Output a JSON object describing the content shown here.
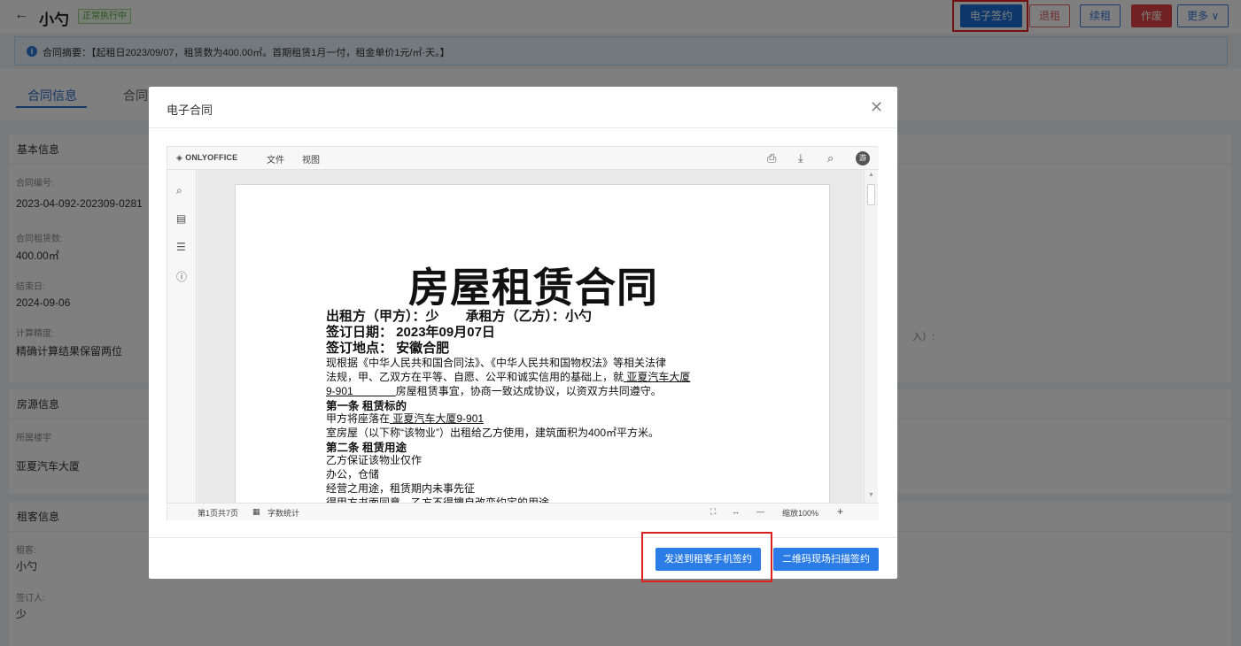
{
  "header": {
    "back_icon": "arrow-left-icon",
    "title": "小勺",
    "status": "正常执行中",
    "buttons": {
      "esign": "电子签约",
      "return": "退租",
      "renew": "续租",
      "void": "作废",
      "more": "更多 ∨"
    }
  },
  "summary": {
    "icon": "info-icon",
    "text": "合同摘要：【起租日2023/09/07，租赁数为400.00㎡。首期租赁1月一付，租金单价1元/㎡·天。】"
  },
  "tabs": [
    "合同信息",
    "合同"
  ],
  "basic_info": {
    "heading": "基本信息",
    "fields": [
      {
        "label": "合同编号:",
        "value": "2023-04-092-202309-0281"
      },
      {
        "label": "合同租赁数:",
        "value": "400.00㎡"
      },
      {
        "label": "结束日:",
        "value": "2024-09-06"
      },
      {
        "label": "计算精度:",
        "value": "精确计算结果保留两位"
      }
    ],
    "right_fragment": "入）:"
  },
  "property_info": {
    "heading": "房源信息",
    "fields": [
      {
        "label": "所属楼宇",
        "value": "亚夏汽车大厦"
      }
    ]
  },
  "tenant_info": {
    "heading": "租客信息",
    "fields": [
      {
        "label": "租客:",
        "value": "小勺"
      },
      {
        "label": "签订人:",
        "value": "少"
      }
    ]
  },
  "modal": {
    "title": "电子合同",
    "close_icon": "close-icon",
    "viewer": {
      "logo": "ONLYOFFICE",
      "menu": [
        "文件",
        "视图"
      ],
      "toolbar_icons": [
        "print-icon",
        "download-icon",
        "search-icon"
      ],
      "avatar": "游",
      "left_icons": [
        "search-icon",
        "comment-icon",
        "outline-icon",
        "info-icon"
      ],
      "status": {
        "page": "第1页共7页",
        "word_count": "字数统计",
        "zoom": "缩放100%",
        "zoom_minus": "—",
        "zoom_plus": "+"
      }
    },
    "document": {
      "title": "房屋租赁合同",
      "line1": "出租方（甲方）：少　　承租方（乙方）：小勺",
      "line2": "签订日期：  2023年09月07日",
      "line3": "签订地点：  安徽合肥",
      "para1a": "现根据《中华人民共和国合同法》、《中华人民共和国物权法》等相关法律",
      "para1b_pre": "法规，甲、乙双方在平等、自愿、公平和诚实信用的基础上，就",
      "para1b_u": " 亚夏汽车大厦",
      "para1c_u": "9-901　　　　",
      "para1c_post": "房屋租赁事宜，协商一致达成协议，以资双方共同遵守。",
      "art1": "第一条  租赁标的",
      "art1a_pre": "甲方将座落在",
      "art1a_u": " 亚夏汽车大厦9-901  ",
      "art1b": "室房屋（以下称“该物业”）出租给乙方使用，建筑面积为400㎡平方米。",
      "art2": "第二条  租赁用途",
      "art2a": "乙方保证该物业仅作",
      "art2b": "办公，仓储",
      "art2c": "经营之用途，租赁期内未事先征",
      "art2d": "得甲方书面同意，乙方不得擅自改变约定的用途。"
    },
    "footer_buttons": {
      "send_mobile": "发送到租客手机签约",
      "qr_sign": "二维码现场扫描签约"
    }
  },
  "highlight_color": "#e02020"
}
